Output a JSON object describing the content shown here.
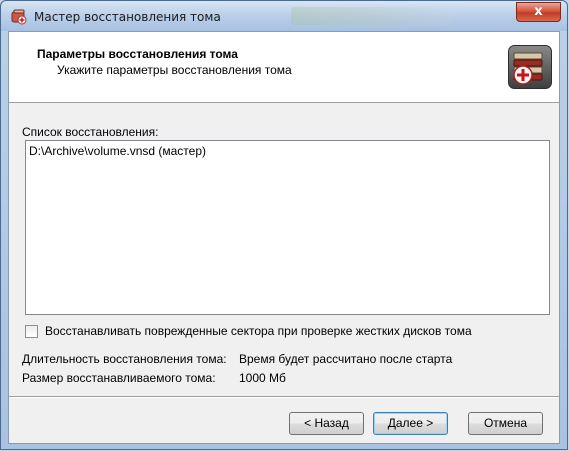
{
  "window": {
    "title": "Мастер восстановления тома",
    "close_label": "x"
  },
  "header": {
    "title": "Параметры восстановления тома",
    "subtitle": "Укажите параметры восстановления тома"
  },
  "restore_list": {
    "label": "Список восстановления:",
    "items": [
      "D:\\Archive\\volume.vnsd (мастер)"
    ]
  },
  "options": {
    "repair_sectors_label": "Восстанавливать поврежденные сектора при проверке жестких дисков тома",
    "repair_sectors_checked": false
  },
  "info": {
    "duration_label": "Длительность восстановления тома:",
    "duration_value": "Время будет рассчитано после старта",
    "size_label": "Размер восстанавливаемого тома:",
    "size_value": "1000 Мб"
  },
  "buttons": {
    "back": "< Назад",
    "next": "Далее >",
    "cancel": "Отмена"
  }
}
